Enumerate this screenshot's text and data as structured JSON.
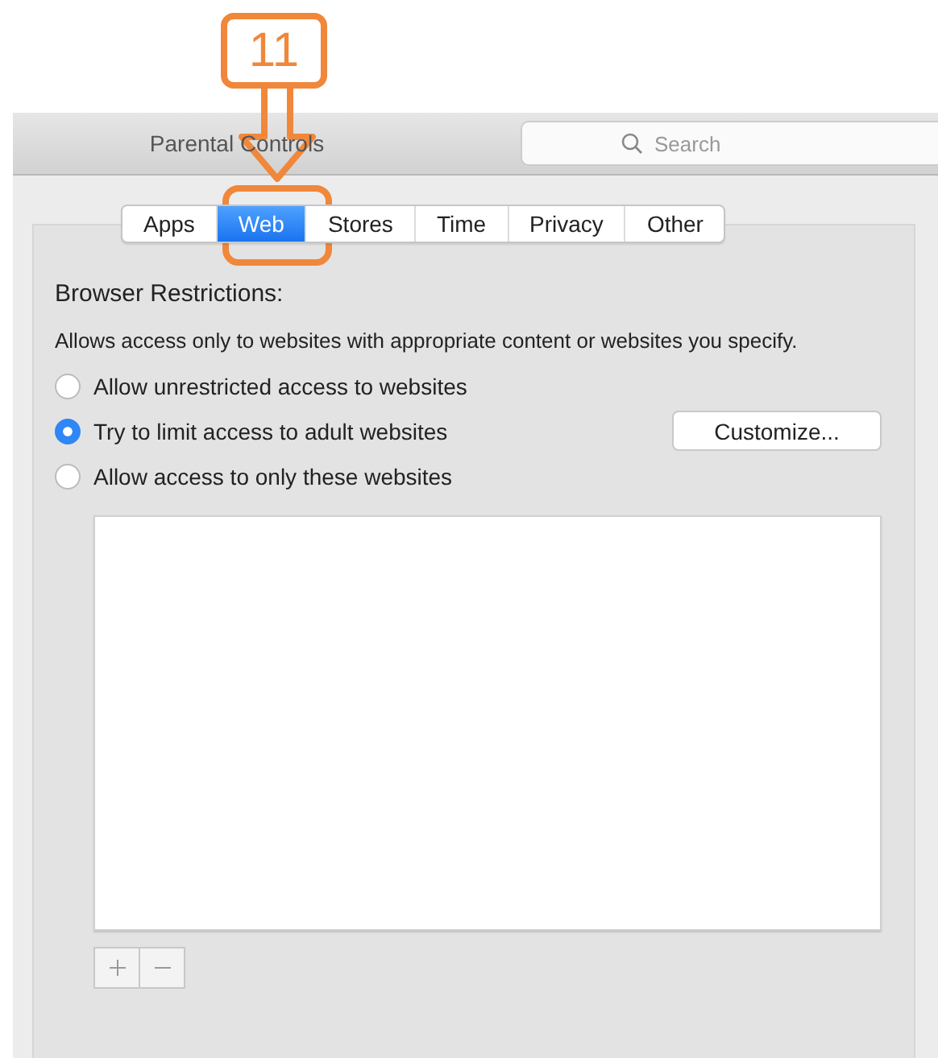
{
  "annotation": {
    "label": "11"
  },
  "window": {
    "title": "Parental Controls"
  },
  "search": {
    "placeholder": "Search"
  },
  "tabs": [
    {
      "label": "Apps",
      "selected": false
    },
    {
      "label": "Web",
      "selected": true
    },
    {
      "label": "Stores",
      "selected": false
    },
    {
      "label": "Time",
      "selected": false
    },
    {
      "label": "Privacy",
      "selected": false
    },
    {
      "label": "Other",
      "selected": false
    }
  ],
  "section": {
    "heading": "Browser Restrictions:",
    "description": "Allows access only to websites with appropriate content or websites you specify."
  },
  "options": [
    {
      "label": "Allow unrestricted access to websites",
      "selected": false
    },
    {
      "label": "Try to limit access to adult websites",
      "selected": true,
      "button": "Customize..."
    },
    {
      "label": "Allow access to only these websites",
      "selected": false
    }
  ],
  "list_buttons": [
    {
      "kind": "add"
    },
    {
      "kind": "remove"
    }
  ]
}
